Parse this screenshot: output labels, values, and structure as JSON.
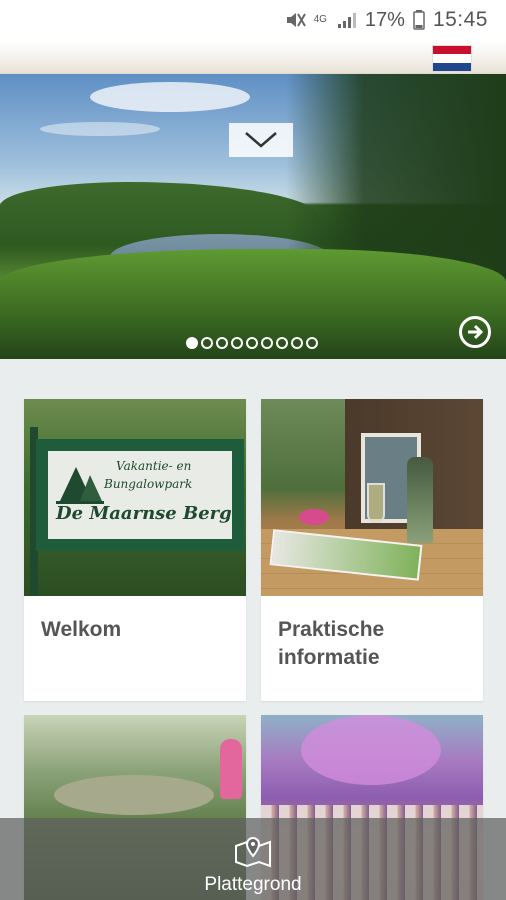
{
  "status_bar": {
    "network_top": "4G",
    "network_bottom": "",
    "battery": "17%",
    "time": "15:45"
  },
  "header": {
    "flag_icon": "netherlands-flag",
    "flag_colors": [
      "#c8102e",
      "#ffffff",
      "#21468b"
    ]
  },
  "hero": {
    "slide_count": 9,
    "active_slide": 1,
    "toggle_icon": "chevron-down-icon",
    "next_icon": "arrow-right-circle-icon"
  },
  "cards": [
    {
      "label": "Welkom"
    },
    {
      "label": "Praktische informatie"
    },
    {
      "label": ""
    },
    {
      "label": ""
    }
  ],
  "welkom_sign": {
    "line1": "Vakantie- en",
    "line2": "Bungalowpark",
    "line3": "De Maarnse Berg"
  },
  "bottom_bar": {
    "icon": "map-pin-icon",
    "label": "Plattegrond"
  },
  "colors": {
    "background": "#e9eded",
    "card_label": "#555555",
    "bottom_bar": "#5f5f5f"
  }
}
